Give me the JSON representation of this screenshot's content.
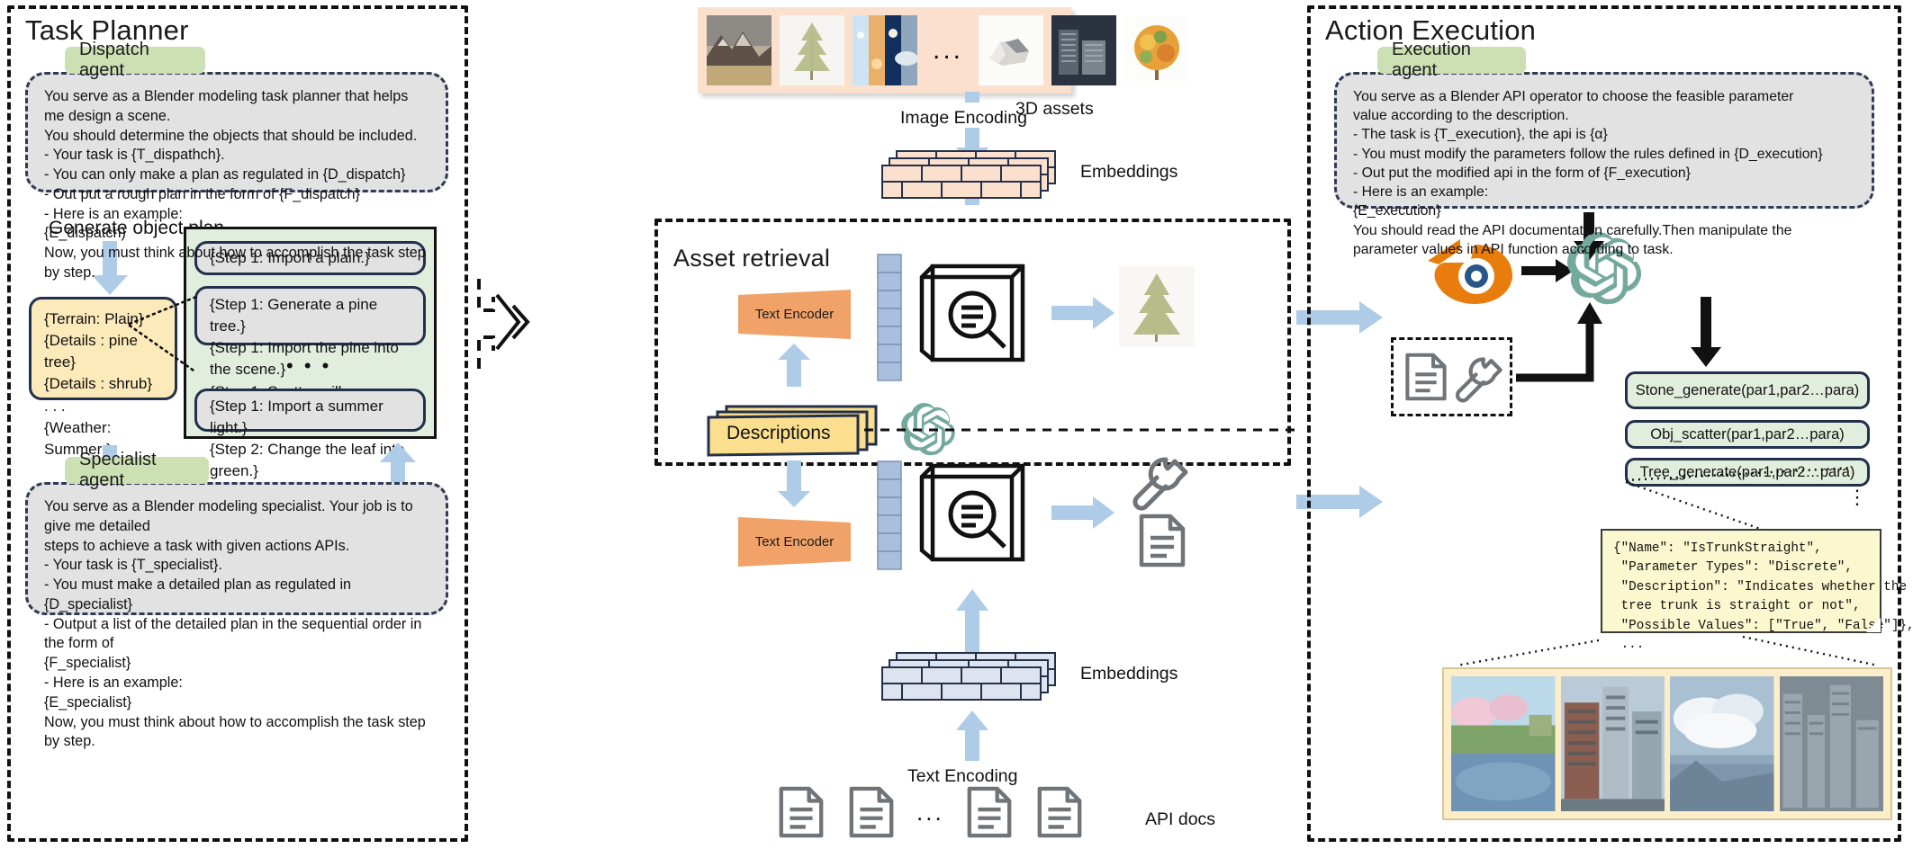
{
  "task_planner": {
    "title": "Task Planner",
    "dispatch_tag": "Dispatch agent",
    "dispatch_prompt": "You serve as a Blender modeling task planner that helps me design a scene.\nYou should determine the objects that should be included.\n- Your task is {T_dispathch}.\n- You can only make a plan as regulated in {D_dispatch}\n- Out put a rough plan in the form of {F_dispatch}\n- Here is an example:\n{E_dispatch)\nNow, you must think about how to accomplish the task step by step.",
    "generate_label": "Generate object plan",
    "object_plan": "{Terrain: Plain}\n{Details : pine tree}\n{Details : shrub}\n            . . .\n{Weather: Summer }",
    "steps": [
      "{Step 1: Import a plain.}",
      "{Step 1: Generate a pine tree.}\n{Step 1: Import the pine into the scene.}\n{Step 1: Scatter willow son the ground.}",
      "{Step 1: Import a summer light.}\n{Step 2: Change the leaf into green.}"
    ],
    "steps_ellipsis": "• • •",
    "specialist_tag": "Specialist agent",
    "specialist_prompt": "You serve as a Blender modeling specialist. Your job is to give me detailed\nsteps to achieve a task with given actions APIs.\n- Your task is {T_specialist}.\n- You must make a detailed plan as regulated in {D_specialist}\n- Output a list of the detailed plan in the sequential order in the form of\n{F_specialist}\n- Here is an example:\n{E_specialist}\nNow, you must think about how to accomplish the task step by step."
  },
  "middle": {
    "assets_ellipsis": "...",
    "assets_caption": "3D assets",
    "image_encoding_label": "Image Encoding",
    "image_embeddings_label": "Embeddings",
    "asset_retrieval_title": "Asset retrieval",
    "text_encoder_top": "Text Encoder",
    "text_encoder_bottom": "Text Encoder",
    "descriptions_label": "Descriptions",
    "text_embeddings_label": "Embeddings",
    "text_encoding_label": "Text Encoding",
    "api_docs_ellipsis": "...",
    "api_docs_label": "API docs"
  },
  "action_execution": {
    "title": "Action Execution",
    "execution_tag": "Execution agent",
    "execution_prompt": "You serve as a Blender API operator to choose the feasible parameter\nvalue according to the description.\n- The task is {T_execution}, the api is {α}\n- You must modify the parameters follow the rules defined in {D_execution}\n- Out put the modified api in the form of {F_execution}\n- Here is an example:\n{E_execution}\nYou should read the API documentation carefully.Then manipulate the\nparameter values in API function according to task.",
    "apis": [
      "Stone_generate(par1,par2…para)",
      "Obj_scatter(par1,par2…para)",
      "Tree_generate(par1,par2…para)"
    ],
    "api_ellipsis": "⋮",
    "json_snippet": "{\"Name\": \"IsTrunkStraight\",\n \"Parameter Types\": \"Discrete\",\n \"Description\": \"Indicates whether the\n tree trunk is straight or not\",\n \"Possible Values\": [\"True\", \"False\"]},\n ..."
  },
  "colors": {
    "agent_tag_bg": "#cde0b4",
    "prompt_bg": "#e2e2e2",
    "prompt_border": "#2f3a56",
    "yellow_box": "#fdeaba",
    "steps_bg": "#e2eedd",
    "arrow_blue": "#aecbe8",
    "asset_strip_bg": "#fbe0cd",
    "text_encoder_bg": "#f0a268",
    "embed_blue": "#aabfdd",
    "blender_orange": "#e87d0d",
    "openai_green": "#74aa9c",
    "json_bg": "#fbf7ce",
    "result_bg": "#fdeec9"
  }
}
